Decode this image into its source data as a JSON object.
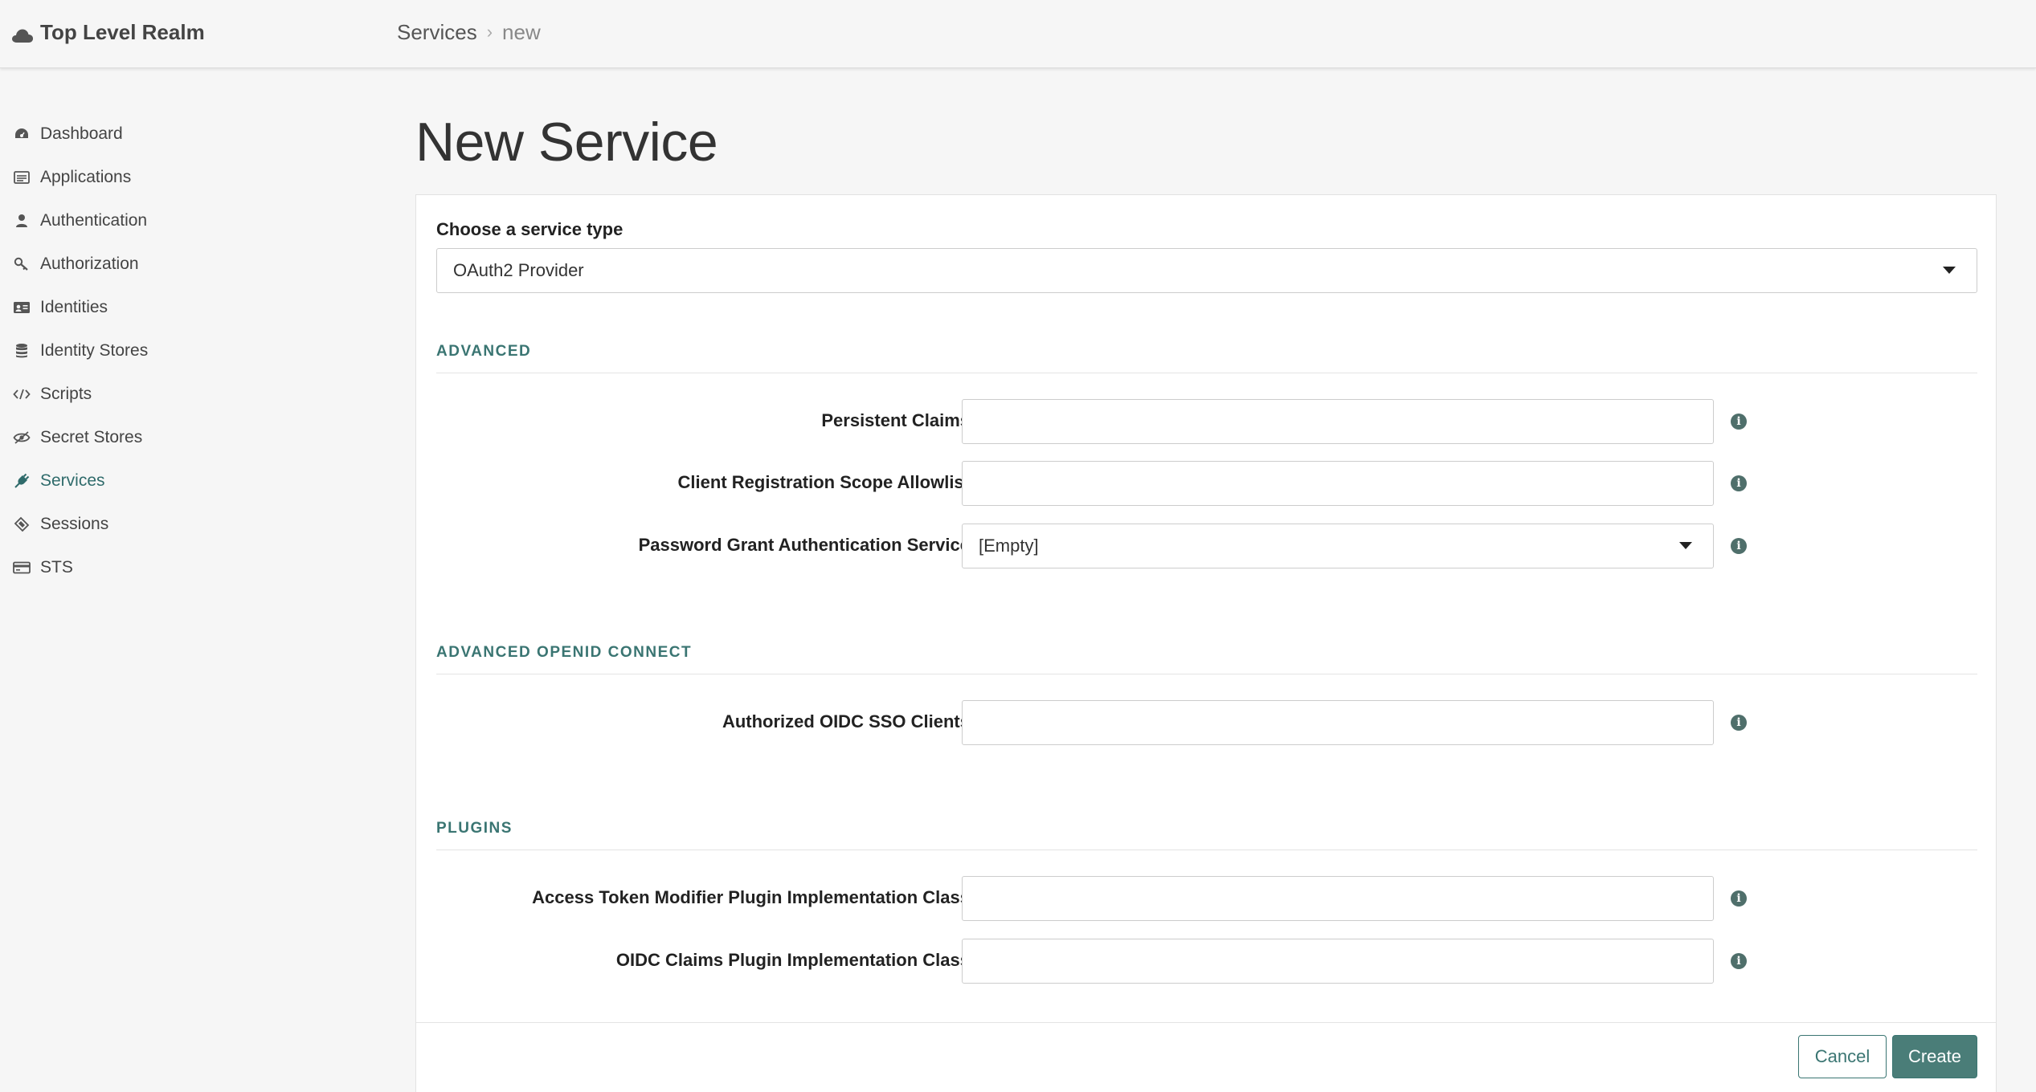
{
  "header": {
    "realm_name": "Top Level Realm",
    "breadcrumb": {
      "parent": "Services",
      "separator": "›",
      "current": "new"
    }
  },
  "sidebar": {
    "items": [
      {
        "label": "Dashboard",
        "icon": "dashboard-icon"
      },
      {
        "label": "Applications",
        "icon": "applications-icon"
      },
      {
        "label": "Authentication",
        "icon": "user-icon"
      },
      {
        "label": "Authorization",
        "icon": "key-icon"
      },
      {
        "label": "Identities",
        "icon": "id-card-icon"
      },
      {
        "label": "Identity Stores",
        "icon": "database-icon"
      },
      {
        "label": "Scripts",
        "icon": "code-icon"
      },
      {
        "label": "Secret Stores",
        "icon": "eye-slash-icon"
      },
      {
        "label": "Services",
        "icon": "plug-icon",
        "active": true
      },
      {
        "label": "Sessions",
        "icon": "ticket-icon"
      },
      {
        "label": "STS",
        "icon": "credit-card-icon"
      }
    ]
  },
  "page": {
    "title": "New Service"
  },
  "form": {
    "service_type_label": "Choose a service type",
    "service_type_value": "OAuth2 Provider",
    "sections": {
      "advanced": "ADVANCED",
      "advanced_oidc": "ADVANCED OPENID CONNECT",
      "plugins": "PLUGINS"
    },
    "fields": {
      "persistent_claims": {
        "label": "Persistent Claims",
        "value": ""
      },
      "client_reg_scope": {
        "label": "Client Registration Scope Allowlist",
        "value": ""
      },
      "password_grant": {
        "label": "Password Grant Authentication Service",
        "value": "[Empty]"
      },
      "authorized_oidc": {
        "label": "Authorized OIDC SSO Clients",
        "value": ""
      },
      "access_token_plugin": {
        "label": "Access Token Modifier Plugin Implementation Class",
        "value": ""
      },
      "oidc_claims_plugin": {
        "label": "OIDC Claims Plugin Implementation Class",
        "value": ""
      }
    },
    "buttons": {
      "cancel": "Cancel",
      "create": "Create"
    }
  },
  "colors": {
    "accent": "#3a7572",
    "primary_button": "#4a7d78",
    "background": "#f6f6f6"
  }
}
